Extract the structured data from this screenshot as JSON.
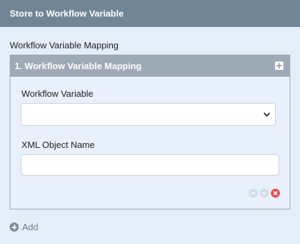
{
  "header": {
    "title": "Store to Workflow Variable"
  },
  "section": {
    "label": "Workflow Variable Mapping"
  },
  "panel": {
    "title": "1. Workflow Variable Mapping",
    "fields": {
      "variable_label": "Workflow Variable",
      "variable_value": "",
      "xml_label": "XML Object Name",
      "xml_value": ""
    }
  },
  "actions": {
    "add_label": "Add"
  },
  "icons": {
    "panel_add": "plus-square-icon",
    "select": "chevron-down-icon",
    "move_up": "chevron-up-icon",
    "move_down": "chevron-down-icon",
    "remove": "close-circle-icon",
    "add": "plus-circle-icon"
  },
  "colors": {
    "header_bg": "#708696",
    "panel_header_bg": "#9eaab5",
    "page_bg": "#e3eef9",
    "remove": "#e05252"
  }
}
